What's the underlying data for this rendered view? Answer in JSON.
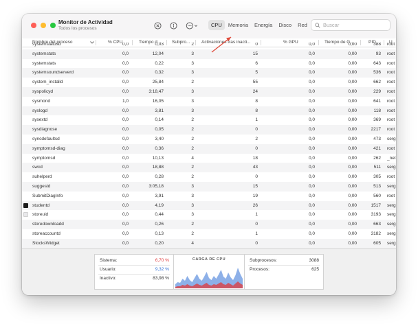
{
  "window": {
    "title": "Monitor de Actividad",
    "subtitle": "Todos los procesos"
  },
  "toolbar": {
    "stop_icon": "x-circle-icon",
    "info_icon": "info-circle-icon",
    "more_icon": "ellipsis-circle-icon"
  },
  "tabs": [
    "CPU",
    "Memoria",
    "Energía",
    "Disco",
    "Red"
  ],
  "active_tab": "CPU",
  "search": {
    "placeholder": "Buscar",
    "value": ""
  },
  "columns": [
    "Nombre del proceso",
    "% CPU",
    "Tiempo d...",
    "Subpro...",
    "Activaciones tras inacti...",
    "% GPU",
    "Tiempo de G...",
    "PID",
    "U"
  ],
  "processes": [
    {
      "name": "systemstatusd",
      "cpu": "0,0",
      "time": "0,03",
      "threads": "2",
      "wakeups": "0",
      "gpu": "0,0",
      "gpu_time": "0,00",
      "pid": "388",
      "user": "root",
      "icon": ""
    },
    {
      "name": "systemstats",
      "cpu": "0,0",
      "time": "12,04",
      "threads": "3",
      "wakeups": "15",
      "gpu": "0,0",
      "gpu_time": "0,00",
      "pid": "93",
      "user": "root",
      "icon": ""
    },
    {
      "name": "systemstats",
      "cpu": "0,0",
      "time": "0,22",
      "threads": "3",
      "wakeups": "6",
      "gpu": "0,0",
      "gpu_time": "0,00",
      "pid": "643",
      "user": "root",
      "icon": ""
    },
    {
      "name": "systemsoundserverd",
      "cpu": "0,0",
      "time": "0,32",
      "threads": "3",
      "wakeups": "5",
      "gpu": "0,0",
      "gpu_time": "0,00",
      "pid": "536",
      "user": "root",
      "icon": ""
    },
    {
      "name": "system_installd",
      "cpu": "0,0",
      "time": "25,84",
      "threads": "2",
      "wakeups": "55",
      "gpu": "0,0",
      "gpu_time": "0,00",
      "pid": "662",
      "user": "root",
      "icon": ""
    },
    {
      "name": "syspolicyd",
      "cpu": "0,0",
      "time": "3:18,47",
      "threads": "3",
      "wakeups": "24",
      "gpu": "0,0",
      "gpu_time": "0,00",
      "pid": "229",
      "user": "root",
      "icon": ""
    },
    {
      "name": "sysmond",
      "cpu": "1,0",
      "time": "16,05",
      "threads": "3",
      "wakeups": "8",
      "gpu": "0,0",
      "gpu_time": "0,00",
      "pid": "641",
      "user": "root",
      "icon": ""
    },
    {
      "name": "syslogd",
      "cpu": "0,0",
      "time": "3,81",
      "threads": "3",
      "wakeups": "8",
      "gpu": "0,0",
      "gpu_time": "0,00",
      "pid": "118",
      "user": "root",
      "icon": ""
    },
    {
      "name": "sysextd",
      "cpu": "0,0",
      "time": "0,14",
      "threads": "2",
      "wakeups": "1",
      "gpu": "0,0",
      "gpu_time": "0,00",
      "pid": "369",
      "user": "root",
      "icon": ""
    },
    {
      "name": "sysdiagnose",
      "cpu": "0,0",
      "time": "0,05",
      "threads": "2",
      "wakeups": "0",
      "gpu": "0,0",
      "gpu_time": "0,00",
      "pid": "2217",
      "user": "root",
      "icon": ""
    },
    {
      "name": "syncdefaultsd",
      "cpu": "0,0",
      "time": "3,40",
      "threads": "2",
      "wakeups": "2",
      "gpu": "0,0",
      "gpu_time": "0,00",
      "pid": "473",
      "user": "serg",
      "icon": ""
    },
    {
      "name": "symptomsd-diag",
      "cpu": "0,0",
      "time": "0,36",
      "threads": "2",
      "wakeups": "0",
      "gpu": "0,0",
      "gpu_time": "0,00",
      "pid": "421",
      "user": "root",
      "icon": ""
    },
    {
      "name": "symptomsd",
      "cpu": "0,0",
      "time": "10,13",
      "threads": "4",
      "wakeups": "18",
      "gpu": "0,0",
      "gpu_time": "0,00",
      "pid": "262",
      "user": "_net",
      "icon": ""
    },
    {
      "name": "swcd",
      "cpu": "0,0",
      "time": "18,88",
      "threads": "2",
      "wakeups": "43",
      "gpu": "0,0",
      "gpu_time": "0,00",
      "pid": "511",
      "user": "serg",
      "icon": ""
    },
    {
      "name": "suhelperd",
      "cpu": "0,0",
      "time": "0,28",
      "threads": "2",
      "wakeups": "0",
      "gpu": "0,0",
      "gpu_time": "0,00",
      "pid": "305",
      "user": "root",
      "icon": ""
    },
    {
      "name": "suggestd",
      "cpu": "0,0",
      "time": "3:05,18",
      "threads": "3",
      "wakeups": "15",
      "gpu": "0,0",
      "gpu_time": "0,00",
      "pid": "513",
      "user": "serg",
      "icon": ""
    },
    {
      "name": "SubmitDiagInfo",
      "cpu": "0,0",
      "time": "3,91",
      "threads": "3",
      "wakeups": "19",
      "gpu": "0,0",
      "gpu_time": "0,00",
      "pid": "560",
      "user": "root",
      "icon": ""
    },
    {
      "name": "studentd",
      "cpu": "0,0",
      "time": "4,19",
      "threads": "3",
      "wakeups": "26",
      "gpu": "0,0",
      "gpu_time": "0,00",
      "pid": "1517",
      "user": "serg",
      "icon": "terminal-icon"
    },
    {
      "name": "storeuid",
      "cpu": "0,0",
      "time": "0,44",
      "threads": "3",
      "wakeups": "1",
      "gpu": "0,0",
      "gpu_time": "0,00",
      "pid": "3193",
      "user": "serg",
      "icon": "document-icon"
    },
    {
      "name": "storedownloadd",
      "cpu": "0,0",
      "time": "0,26",
      "threads": "2",
      "wakeups": "0",
      "gpu": "0,0",
      "gpu_time": "0,00",
      "pid": "663",
      "user": "serg",
      "icon": ""
    },
    {
      "name": "storeaccountd",
      "cpu": "0,0",
      "time": "0,13",
      "threads": "2",
      "wakeups": "1",
      "gpu": "0,0",
      "gpu_time": "0,00",
      "pid": "3182",
      "user": "serg",
      "icon": ""
    },
    {
      "name": "StocksWidget",
      "cpu": "0,0",
      "time": "0,20",
      "threads": "4",
      "wakeups": "0",
      "gpu": "0,0",
      "gpu_time": "0,00",
      "pid": "605",
      "user": "serg",
      "icon": ""
    }
  ],
  "summary": {
    "sistema_label": "Sistema:",
    "sistema_value": "6,70 %",
    "usuario_label": "Usuario:",
    "usuario_value": "9,32 %",
    "inactivo_label": "Inactivo:",
    "inactivo_value": "83,98 %",
    "chart_title": "CARGA DE CPU",
    "subprocesos_label": "Subprocesos:",
    "subprocesos_value": "3088",
    "procesos_label": "Procesos:",
    "procesos_value": "625"
  },
  "colors": {
    "system": "#e0393b",
    "user": "#2f6fd6",
    "accent": "#e04a3a"
  },
  "cpu_load": {
    "user": [
      4,
      6,
      5,
      9,
      7,
      12,
      8,
      6,
      10,
      14,
      9,
      7,
      11,
      16,
      10,
      8,
      12,
      9,
      13,
      18,
      11,
      9,
      15,
      10,
      8,
      12,
      20,
      14,
      9
    ],
    "system": [
      2,
      3,
      3,
      5,
      4,
      6,
      4,
      3,
      5,
      7,
      5,
      4,
      6,
      8,
      5,
      4,
      6,
      5,
      7,
      9,
      6,
      5,
      8,
      6,
      4,
      7,
      10,
      7,
      5
    ]
  }
}
